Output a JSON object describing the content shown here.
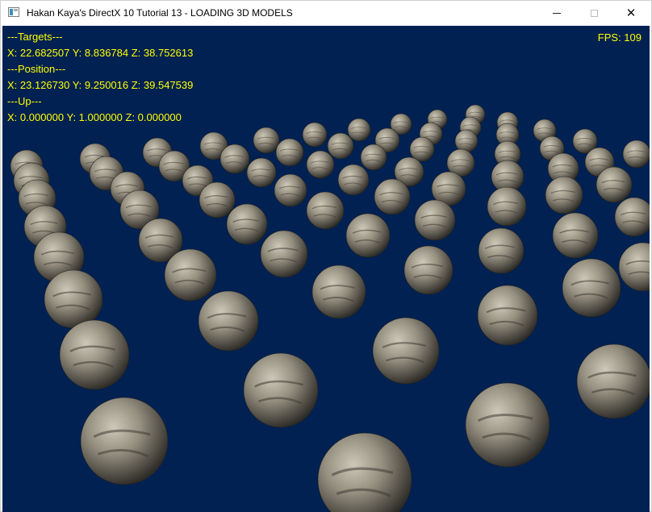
{
  "window": {
    "title": "Hakan Kaya's DirectX 10 Tutorial 13 - LOADING 3D MODELS",
    "close_glyph": "✕"
  },
  "hud": {
    "targets_header": "---Targets---",
    "targets_value": "X: 22.682507 Y: 8.836784 Z: 38.752613",
    "position_header": "---Position---",
    "position_value": "X: 23.126730 Y: 9.250016 Z: 39.547539",
    "up_header": "---Up---",
    "up_value": "X: 0.000000 Y: 1.000000 Z: 0.000000",
    "fps": "FPS: 109"
  },
  "colors": {
    "background": "#002152",
    "hud_text": "#ffff00",
    "sphere_light": "#c8c4b4",
    "sphere_mid": "#8f8a7c",
    "sphere_dark": "#3a3833"
  }
}
